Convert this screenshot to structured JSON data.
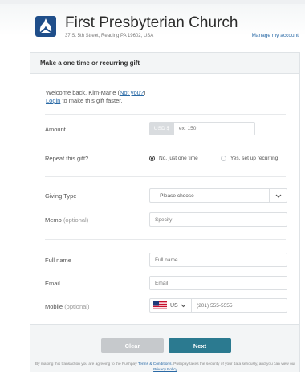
{
  "header": {
    "church_name": "First Presbyterian Church",
    "address": "37 S. 5th Street, Reading PA 19602, USA",
    "manage_account": "Manage my account"
  },
  "form": {
    "title": "Make a one time or recurring gift",
    "welcome_prefix": "Welcome back, Kim-Marie (",
    "not_you": "Not you?",
    "welcome_suffix": ")",
    "login_link": "Login",
    "login_suffix": " to make this gift faster.",
    "amount_label": "Amount",
    "currency": "USD $",
    "amount_placeholder": "ex. 150",
    "repeat_label": "Repeat this gift?",
    "repeat_options": [
      "No, just one time",
      "Yes, set up recurring"
    ],
    "repeat_selected": "No, just one time",
    "giving_type_label": "Giving Type",
    "giving_type_value": "-- Please choose --",
    "memo_label": "Memo",
    "optional": "(optional)",
    "memo_placeholder": "Specify",
    "fullname_label": "Full name",
    "fullname_placeholder": "Full name",
    "email_label": "Email",
    "email_placeholder": "Email",
    "mobile_label": "Mobile",
    "country_code": "US",
    "phone_placeholder": "(201) 555-5555"
  },
  "actions": {
    "clear": "Clear",
    "next": "Next"
  },
  "terms": {
    "prefix": "By making this transaction you are agreeing to the Pushpay ",
    "link": "Terms & Conditions",
    "suffix": ". Pushpay takes the security of your data seriously, and you can view our ",
    "policy": "Privacy Policy"
  },
  "colors": {
    "accent": "#2b7a90",
    "link": "#2a6aa6",
    "logo": "#1f4e8a"
  }
}
